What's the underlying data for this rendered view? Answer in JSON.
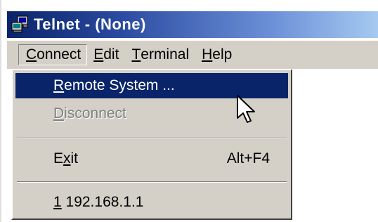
{
  "window": {
    "title": "Telnet - (None)"
  },
  "menubar": {
    "items": [
      {
        "label": "Connect",
        "underline": "C",
        "rest": "onnect"
      },
      {
        "label": "Edit",
        "underline": "E",
        "rest": "dit"
      },
      {
        "label": "Terminal",
        "underline": "T",
        "rest": "erminal"
      },
      {
        "label": "Help",
        "underline": "H",
        "rest": "elp"
      }
    ]
  },
  "dropdown": {
    "items": [
      {
        "label": "Remote System ...",
        "underline": "R",
        "rest": "emote System ...",
        "state": "selected"
      },
      {
        "label": "Disconnect",
        "underline": "D",
        "rest": "isconnect",
        "state": "disabled"
      },
      {
        "label": "Exit",
        "pre": "E",
        "underline": "x",
        "rest": "it",
        "shortcut": "Alt+F4"
      },
      {
        "label": "1 192.168.1.1",
        "underline": "1",
        "rest": " 192.168.1.1"
      }
    ]
  },
  "icons": {
    "title_icon": "telnet-computer-icon",
    "cursor": "mouse-pointer-icon"
  },
  "colors": {
    "titlebar_start": "#0a246a",
    "titlebar_end": "#a6caf0",
    "menu_bg": "#d4d0c8",
    "highlight": "#0a246a"
  }
}
